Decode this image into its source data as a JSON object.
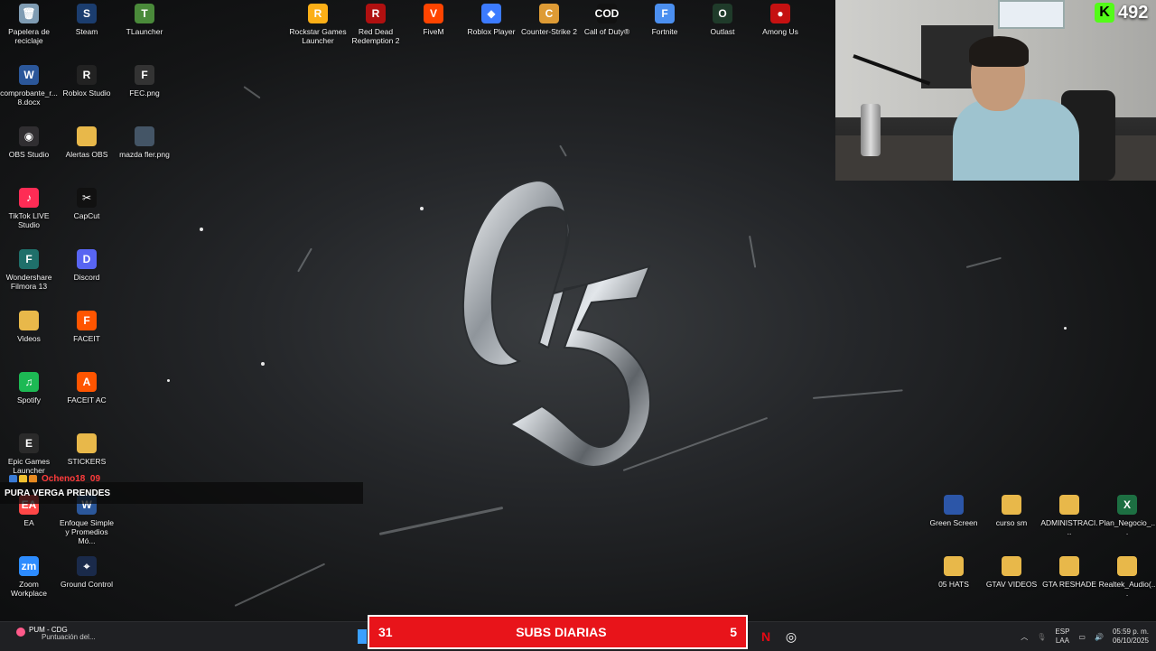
{
  "desktop": {
    "left_icons": [
      {
        "label": "Papelera de reciclaje",
        "icon": "recycle-bin-icon",
        "color": "#7f9cb3",
        "glyph": "🗑"
      },
      {
        "label": "Steam",
        "icon": "steam-icon",
        "color": "#1b3d6e",
        "glyph": "S"
      },
      {
        "label": "TLauncher",
        "icon": "tlauncher-icon",
        "color": "#4a8a3a",
        "glyph": "T"
      },
      {
        "label": "comprobante_r... 8.docx",
        "icon": "word-document-icon",
        "color": "#2b579a",
        "glyph": "W"
      },
      {
        "label": "Roblox Studio",
        "icon": "roblox-studio-icon",
        "color": "#222222",
        "glyph": "R"
      },
      {
        "label": "FEC.png",
        "icon": "image-file-icon",
        "color": "#333333",
        "glyph": "F"
      },
      {
        "label": "OBS Studio",
        "icon": "obs-icon",
        "color": "#302e31",
        "glyph": "◉"
      },
      {
        "label": "Alertas OBS",
        "icon": "folder-icon",
        "color": "#e8b84a",
        "glyph": ""
      },
      {
        "label": "mazda fler.png",
        "icon": "image-file-icon",
        "color": "#445566",
        "glyph": ""
      },
      {
        "label": "TikTok LIVE Studio",
        "icon": "tiktok-live-icon",
        "color": "#fe2c55",
        "glyph": "♪"
      },
      {
        "label": "CapCut",
        "icon": "capcut-icon",
        "color": "#111111",
        "glyph": "✂"
      },
      {
        "label": "Wondershare Filmora 13",
        "icon": "filmora-icon",
        "color": "#1f6f6a",
        "glyph": "F"
      },
      {
        "label": "Discord",
        "icon": "discord-icon",
        "color": "#5865f2",
        "glyph": "D"
      },
      {
        "label": "Videos",
        "icon": "folder-icon",
        "color": "#e8b84a",
        "glyph": ""
      },
      {
        "label": "FACEIT",
        "icon": "faceit-icon",
        "color": "#ff5500",
        "glyph": "F"
      },
      {
        "label": "Spotify",
        "icon": "spotify-icon",
        "color": "#1db954",
        "glyph": "♫"
      },
      {
        "label": "FACEIT AC",
        "icon": "faceit-ac-icon",
        "color": "#ff5500",
        "glyph": "A"
      },
      {
        "label": "Epic Games Launcher",
        "icon": "epic-games-icon",
        "color": "#2a2a2a",
        "glyph": "E"
      },
      {
        "label": "STICKERS",
        "icon": "folder-icon",
        "color": "#e8b84a",
        "glyph": ""
      },
      {
        "label": "EA",
        "icon": "ea-icon",
        "color": "#ff4747",
        "glyph": "EA"
      },
      {
        "label": "Enfoque Simple y Promedios Mó...",
        "icon": "word-document-icon",
        "color": "#2b579a",
        "glyph": "W"
      },
      {
        "label": "Zoom Workplace",
        "icon": "zoom-icon",
        "color": "#2d8cff",
        "glyph": "zm"
      },
      {
        "label": "Ground Control",
        "icon": "ground-control-icon",
        "color": "#1a2a4a",
        "glyph": "⌖"
      }
    ],
    "top_icons": [
      {
        "label": "Rockstar Games Launcher",
        "icon": "rockstar-icon",
        "color": "#fcaf17",
        "glyph": "R"
      },
      {
        "label": "Red Dead Redemption 2",
        "icon": "rdr2-icon",
        "color": "#b01010",
        "glyph": "R"
      },
      {
        "label": "FiveM",
        "icon": "fivem-icon",
        "color": "#f40",
        "glyph": "V"
      },
      {
        "label": "Roblox Player",
        "icon": "roblox-icon",
        "color": "#3c7bff",
        "glyph": "◆"
      },
      {
        "label": "Counter-Strike 2",
        "icon": "cs2-icon",
        "color": "#de9b35",
        "glyph": "C"
      },
      {
        "label": "Call of Duty®",
        "icon": "call-of-duty-icon",
        "color": "#111111",
        "glyph": "COD"
      },
      {
        "label": "Fortnite",
        "icon": "fortnite-icon",
        "color": "#4b8ff0",
        "glyph": "F"
      },
      {
        "label": "Outlast",
        "icon": "outlast-icon",
        "color": "#1f3b2a",
        "glyph": "O"
      },
      {
        "label": "Among Us",
        "icon": "among-us-icon",
        "color": "#c51111",
        "glyph": "●"
      }
    ],
    "right_icons": [
      {
        "label": "Green Screen",
        "icon": "green-screen-icon",
        "color": "#2c56a8",
        "glyph": ""
      },
      {
        "label": "curso sm",
        "icon": "folder-video-icon",
        "color": "#e8b84a",
        "glyph": ""
      },
      {
        "label": "ADMINISTRACI...",
        "icon": "folder-icon",
        "color": "#e8b84a",
        "glyph": ""
      },
      {
        "label": "Plan_Negocio_...",
        "icon": "excel-icon",
        "color": "#1d6f42",
        "glyph": "X"
      },
      {
        "label": "05 HATS",
        "icon": "folder-video-icon",
        "color": "#e8b84a",
        "glyph": ""
      },
      {
        "label": "GTAV VIDEOS",
        "icon": "folder-video-icon",
        "color": "#e8b84a",
        "glyph": ""
      },
      {
        "label": "GTA RESHADE",
        "icon": "folder-icon",
        "color": "#e8b84a",
        "glyph": ""
      },
      {
        "label": "Realtek_Audio(...",
        "icon": "folder-icon",
        "color": "#e8b84a",
        "glyph": ""
      }
    ]
  },
  "overlay": {
    "kick_count": "492",
    "chat_username": "Ocheno18_09",
    "chat_message": "PURA VERGA PRENDES",
    "subs_left": "31",
    "subs_title": "SUBS DIARIAS",
    "subs_right": "5"
  },
  "taskbar": {
    "weather_title": "PUM - CDG",
    "weather_sub": "Puntuación del...",
    "lang_1": "ESP",
    "lang_2": "LAA",
    "time": "05:59 p. m.",
    "date": "06/10/2025"
  }
}
